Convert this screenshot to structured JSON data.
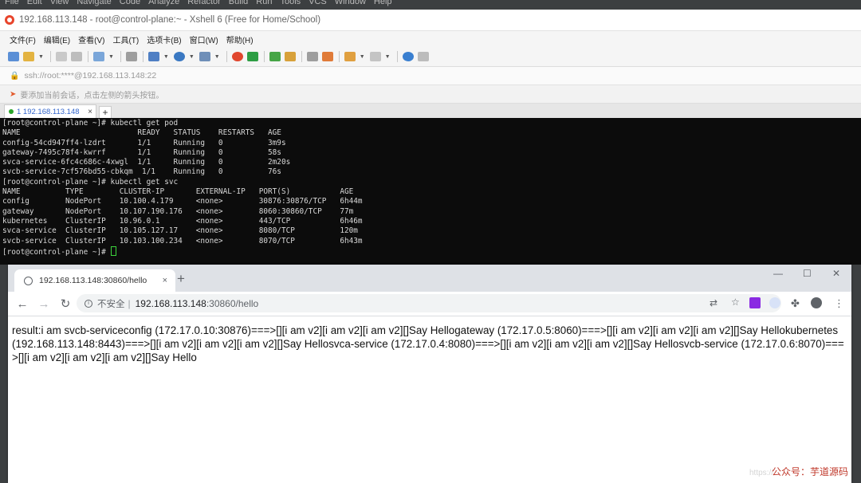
{
  "ide_menubar": [
    "File",
    "Edit",
    "View",
    "Navigate",
    "Code",
    "Analyze",
    "Refactor",
    "Build",
    "Run",
    "Tools",
    "VCS",
    "Window",
    "Help"
  ],
  "xshell": {
    "title": "192.168.113.148 - root@control-plane:~ - Xshell 6 (Free for Home/School)",
    "menu": [
      "文件(F)",
      "编辑(E)",
      "查看(V)",
      "工具(T)",
      "选项卡(B)",
      "窗口(W)",
      "帮助(H)"
    ],
    "address": "ssh://root:****@192.168.113.148:22",
    "hint": "要添加当前会话，点击左侧的箭头按钮。",
    "tab_label": "1 192.168.113.148",
    "tab_close": "×",
    "tab_add": "+",
    "terminal_lines": [
      "[root@control-plane ~]# kubectl get pod",
      "NAME                          READY   STATUS    RESTARTS   AGE",
      "config-54cd947ff4-lzdrt       1/1     Running   0          3m9s",
      "gateway-7495c78f4-kwrrf       1/1     Running   0          58s",
      "svca-service-6fc4c686c-4xwgl  1/1     Running   0          2m20s",
      "svcb-service-7cf576bd55-cbkqm  1/1    Running   0          76s",
      "[root@control-plane ~]# kubectl get svc",
      "NAME          TYPE        CLUSTER-IP       EXTERNAL-IP   PORT(S)           AGE",
      "config        NodePort    10.100.4.179     <none>        30876:30876/TCP   6h44m",
      "gateway       NodePort    10.107.190.176   <none>        8060:30860/TCP    77m",
      "kubernetes    ClusterIP   10.96.0.1        <none>        443/TCP           6h46m",
      "svca-service  ClusterIP   10.105.127.17    <none>        8080/TCP          120m",
      "svcb-service  ClusterIP   10.103.100.234   <none>        8070/TCP          6h43m"
    ],
    "prompt": "[root@control-plane ~]# "
  },
  "chrome": {
    "tab_title": "192.168.113.148:30860/hello",
    "tab_close": "×",
    "new_tab": "+",
    "security_label": "不安全",
    "url_separator": "|",
    "url_host": "192.168.113.148",
    "url_path": ":30860/hello",
    "page_text": "result:i am svcb-serviceconfig (172.17.0.10:30876)===>[][i am v2][i am v2][i am v2][]Say Hellogateway (172.17.0.5:8060)===>[][i am v2][i am v2][i am v2][]Say Hellokubernetes (192.168.113.148:8443)===>[][i am v2][i am v2][i am v2][]Say Hellosvca-service (172.17.0.4:8080)===>[][i am v2][i am v2][i am v2][]Say Hellosvcb-service (172.17.0.6:8070)===>[][i am v2][i am v2][i am v2][]Say Hello"
  },
  "watermark": "公众号：芋道源码",
  "watermark_faint": "https://"
}
